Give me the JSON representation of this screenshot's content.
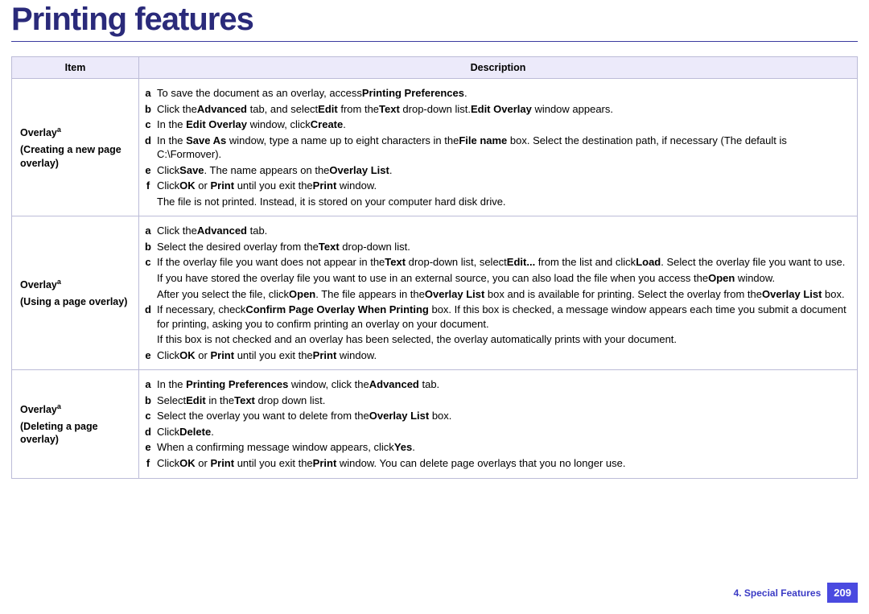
{
  "title": "Printing features",
  "table": {
    "headers": {
      "item": "Item",
      "description": "Description"
    },
    "rows": [
      {
        "item_title": "Overlay",
        "item_super": "a",
        "item_sub": "(Creating a new page overlay)",
        "steps": [
          {
            "marker": "a",
            "parts": [
              "To save the document as an overlay, access",
              "Printing Preferences",
              "."
            ]
          },
          {
            "marker": "b",
            "parts": [
              "Click the",
              "Advanced",
              " tab, and select",
              "Edit",
              " from the",
              "Text",
              " drop-down list.",
              "Edit Overlay",
              " window appears."
            ]
          },
          {
            "marker": "c",
            "parts": [
              "In the ",
              "Edit Overlay",
              " window, click",
              "Create",
              "."
            ]
          },
          {
            "marker": "d",
            "parts": [
              "In the ",
              "Save As",
              " window, type a name up to eight characters in the",
              "File name",
              " box. Select the destination path, if necessary (The default is C:\\Formover)."
            ]
          },
          {
            "marker": "e",
            "parts": [
              "Click",
              "Save",
              ". The name appears on the",
              "Overlay List",
              "."
            ]
          },
          {
            "marker": "f",
            "parts": [
              "Click",
              "OK",
              " or ",
              "Print",
              " until you exit the",
              "Print",
              " window."
            ]
          },
          {
            "marker": "",
            "parts": [
              "The file is not printed. Instead, it is stored on your computer hard disk drive."
            ]
          }
        ]
      },
      {
        "item_title": "Overlay",
        "item_super": "a",
        "item_sub": "(Using a page overlay)",
        "steps": [
          {
            "marker": "a",
            "parts": [
              "Click the",
              "Advanced",
              " tab."
            ]
          },
          {
            "marker": "b",
            "parts": [
              "Select the desired overlay from the",
              "Text",
              " drop-down list."
            ]
          },
          {
            "marker": "c",
            "parts": [
              "If the overlay file you want does not appear in the",
              "Text",
              " drop-down list, select",
              "Edit...",
              " from the list and click",
              "Load",
              ". Select the overlay file you want to use."
            ]
          },
          {
            "marker": "",
            "parts": [
              "If you have stored the overlay file you want to use in an external source, you can also load the file when you access the",
              "Open",
              " window."
            ]
          },
          {
            "marker": "",
            "parts": [
              "After you select the file, click",
              "Open",
              ". The file appears in the",
              "Overlay List",
              " box and is available for printing. Select the overlay from the",
              "Overlay List",
              " box."
            ]
          },
          {
            "marker": "d",
            "parts": [
              "If necessary, check",
              "Confirm Page Overlay When Printing",
              " box. If this box is checked, a message window appears each time you submit a document for printing, asking you to confirm printing an overlay on your document."
            ]
          },
          {
            "marker": "",
            "parts": [
              "If this box is not checked and an overlay has been selected, the overlay automatically prints with your document."
            ]
          },
          {
            "marker": "e",
            "parts": [
              "Click",
              "OK",
              " or ",
              "Print",
              " until you exit the",
              "Print",
              " window."
            ]
          }
        ]
      },
      {
        "item_title": "Overlay",
        "item_super": "a",
        "item_sub": "(Deleting a page overlay)",
        "steps": [
          {
            "marker": "a",
            "parts": [
              "In the ",
              "Printing Preferences",
              " window, click the",
              "Advanced",
              " tab."
            ]
          },
          {
            "marker": "b",
            "parts": [
              "Select",
              "Edit",
              " in the",
              "Text",
              " drop down list."
            ]
          },
          {
            "marker": "c",
            "parts": [
              "Select the overlay you want to delete from the",
              "Overlay List",
              " box."
            ]
          },
          {
            "marker": "d",
            "parts": [
              "Click",
              "Delete",
              "."
            ]
          },
          {
            "marker": "e",
            "parts": [
              "When a confirming message window appears, click",
              "Yes",
              "."
            ]
          },
          {
            "marker": "f",
            "parts": [
              "Click",
              "OK",
              " or ",
              "Print",
              " until you exit the",
              "Print",
              " window. You can delete page overlays that you no longer use."
            ]
          }
        ]
      }
    ]
  },
  "footer": {
    "chapter": "4.  Special Features",
    "page": "209"
  }
}
